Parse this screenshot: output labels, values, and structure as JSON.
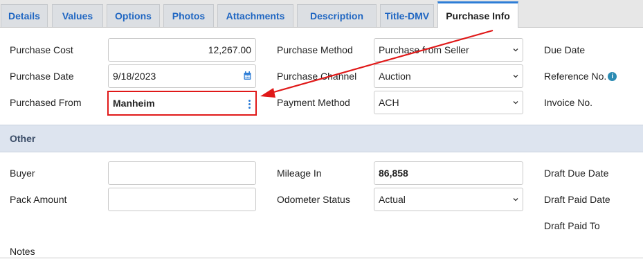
{
  "tabs": [
    {
      "label": "Details"
    },
    {
      "label": "Values"
    },
    {
      "label": "Options"
    },
    {
      "label": "Photos"
    },
    {
      "label": "Attachments"
    },
    {
      "label": "Description"
    },
    {
      "label": "Title-DMV"
    },
    {
      "label": "Purchase Info"
    }
  ],
  "active_tab": "Purchase Info",
  "purchase": {
    "cost_label": "Purchase Cost",
    "cost_value": "12,267.00",
    "date_label": "Purchase Date",
    "date_value": "9/18/2023",
    "from_label": "Purchased From",
    "from_value": "Manheim",
    "method_label": "Purchase Method",
    "method_value": "Purchase from Seller",
    "channel_label": "Purchase Channel",
    "channel_value": "Auction",
    "payment_label": "Payment Method",
    "payment_value": "ACH",
    "due_date_label": "Due Date",
    "reference_label": "Reference No.",
    "invoice_label": "Invoice No."
  },
  "other": {
    "section_title": "Other",
    "buyer_label": "Buyer",
    "buyer_value": "",
    "pack_label": "Pack Amount",
    "pack_value": "",
    "mileage_label": "Mileage In",
    "mileage_value": "86,858",
    "odometer_label": "Odometer Status",
    "odometer_value": "Actual",
    "draft_due_label": "Draft Due Date",
    "draft_paid_label": "Draft Paid Date",
    "draft_paid_to_label": "Draft Paid To",
    "notes_label": "Notes"
  },
  "icons": {
    "info": "i",
    "calendar": "calendar-icon",
    "kebab": "kebab-menu-icon",
    "chevron": "chevron-down-icon"
  },
  "colors": {
    "tab_text": "#1f66c2",
    "highlight": "#e01818",
    "section_bg": "#dde4ef"
  }
}
